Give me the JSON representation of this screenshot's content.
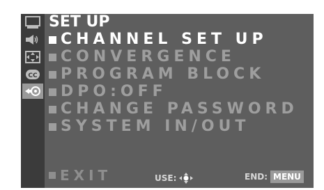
{
  "menu": {
    "title": "SET UP",
    "items": [
      {
        "label": "CHANNEL SET UP",
        "selected": true
      },
      {
        "label": "CONVERGENCE",
        "selected": false
      },
      {
        "label": "PROGRAM BLOCK",
        "selected": false
      },
      {
        "label": "DPO:OFF",
        "selected": false
      },
      {
        "label": "CHANGE PASSWORD",
        "selected": false
      },
      {
        "label": "SYSTEM IN/OUT",
        "selected": false
      }
    ],
    "exit_label": "EXIT"
  },
  "footer": {
    "use_label": "USE:",
    "end_label": "END:",
    "menu_key_label": "MENU"
  },
  "sidebar": {
    "icons": [
      "screen-icon",
      "speaker-icon",
      "pip-icon",
      "cc-icon",
      "setup-icon"
    ],
    "active_icon": "setup-icon"
  },
  "colors": {
    "content_bg": "#5e5e5e",
    "sidebar_bg": "#3b3b3b",
    "selected_text": "#ffffff",
    "normal_text": "#9e9e9e"
  }
}
